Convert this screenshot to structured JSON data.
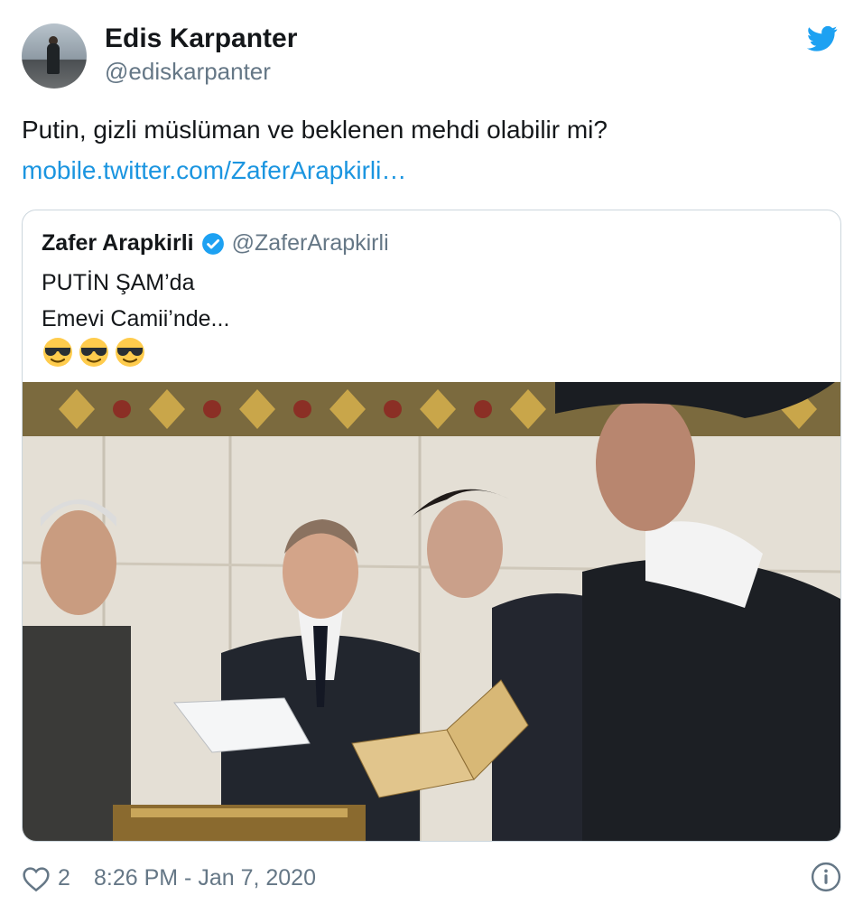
{
  "author": {
    "display_name": "Edis Karpanter",
    "handle": "@ediskarpanter"
  },
  "tweet": {
    "text": "Putin, gizli müslüman ve beklenen mehdi olabilir mi?",
    "link": "mobile.twitter.com/ZaferArapkirli…"
  },
  "quoted_tweet": {
    "display_name": "Zafer Arapkirli",
    "handle": "@ZaferArapkirli",
    "verified": true,
    "line1": "PUTİN ŞAM’da",
    "line2": "Emevi Camii’nde...",
    "emojis": [
      "sunglasses-face",
      "sunglasses-face",
      "sunglasses-face"
    ]
  },
  "footer": {
    "like_count": "2",
    "timestamp": "8:26 PM - Jan 7, 2020"
  },
  "colors": {
    "brand": "#1da1f2",
    "link": "#1b95e0",
    "muted": "#657786",
    "text": "#14171a",
    "border": "#ccd6dd"
  },
  "icons": {
    "logo": "twitter-bird-icon",
    "verified": "verified-badge-icon",
    "like": "heart-icon",
    "info": "info-icon"
  }
}
